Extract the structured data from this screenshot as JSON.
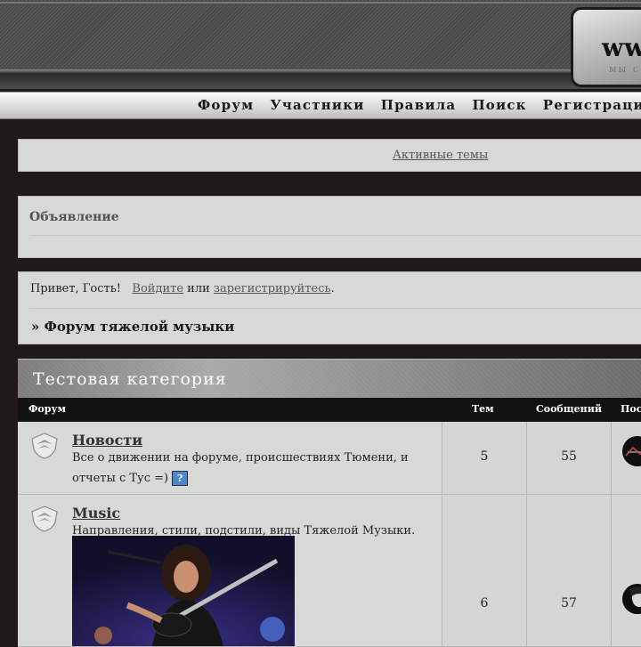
{
  "header": {
    "logo_text": "ww",
    "logo_sub": "мы с"
  },
  "nav": {
    "items": [
      "Форум",
      "Участники",
      "Правила",
      "Поиск",
      "Регистрация"
    ]
  },
  "active_topics": {
    "label": "Активные темы"
  },
  "announcement": {
    "title": "Объявление"
  },
  "welcome": {
    "greeting": "Привет, Гость!",
    "login": "Войдите",
    "or": "или",
    "register": "зарегистрируйтесь",
    "period": "."
  },
  "breadcrumb": {
    "text": "» Форум тяжелой музыки"
  },
  "category": {
    "title": "Тестовая категория"
  },
  "columns": {
    "forum": "Форум",
    "topics": "Тем",
    "posts": "Сообщений",
    "last": "Пос"
  },
  "forums": [
    {
      "name": "Новости",
      "desc": "Все о движении на форуме, происшествиях Тюмени, и отчеты с Тус =)",
      "help": "?",
      "topics": "5",
      "posts": "55"
    },
    {
      "name": "Music",
      "desc": "Направления, стили, подстили, виды Тяжелой Музыки.",
      "topics": "6",
      "posts": "57"
    }
  ],
  "colors": {
    "panel": "#d6d9d6",
    "page_bg": "#1f1a17",
    "header_dark": "#121212"
  }
}
